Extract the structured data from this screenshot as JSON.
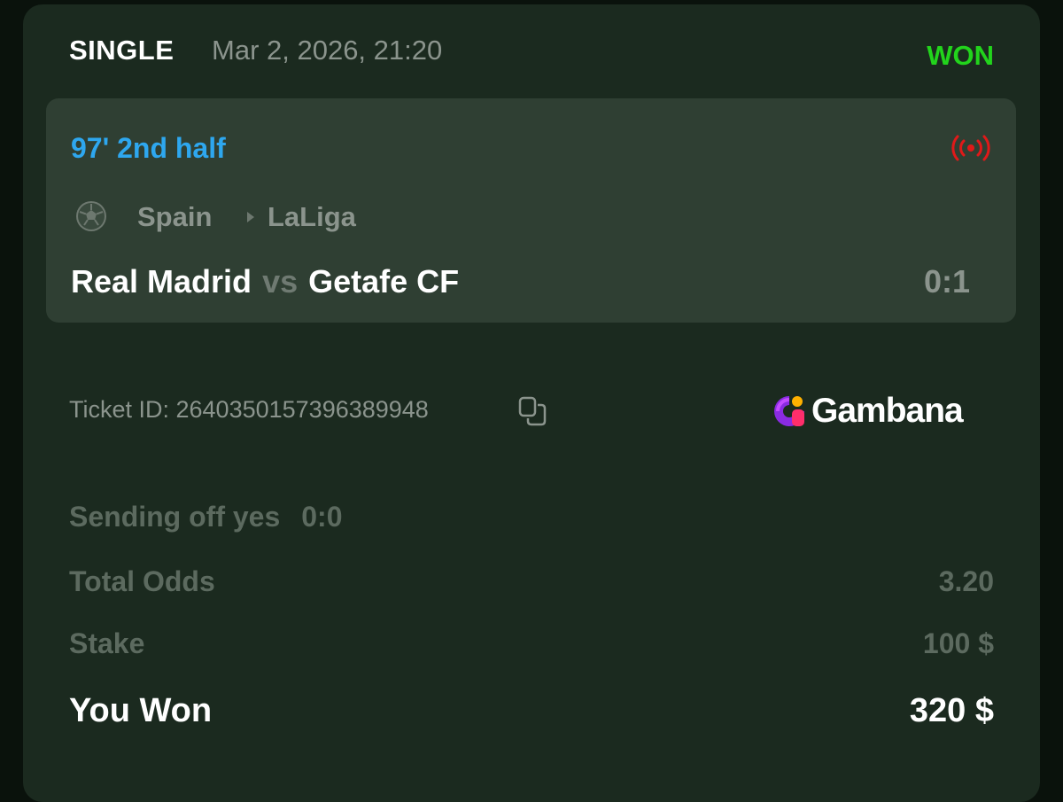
{
  "header": {
    "bet_type": "SINGLE",
    "date": "Mar 2, 2026, 21:20",
    "status": "WON"
  },
  "event": {
    "time_status": "97' 2nd half",
    "live_icon": "live-broadcast-icon",
    "sport_icon": "soccer-ball-icon",
    "country": "Spain",
    "league": "LaLiga",
    "home_team": "Real Madrid",
    "vs": "vs",
    "away_team": "Getafe CF",
    "score": "0:1"
  },
  "ticket": {
    "id_text": "Ticket ID: 2640350157396389948",
    "copy_icon": "copy-icon"
  },
  "brand": {
    "name": "Gambana",
    "logo_icon": "gambana-logo-icon"
  },
  "summary": {
    "selection": "Sending off yes",
    "selection_score": "0:0",
    "total_odds_label": "Total Odds",
    "total_odds_value": "3.20",
    "stake_label": "Stake",
    "stake_value": "100 $",
    "won_label": "You Won",
    "won_value": "320 $"
  },
  "colors": {
    "background": "#0a120c",
    "card": "#1b2a1f",
    "event_card": "#2f3f33",
    "won": "#22d41c",
    "time": "#2ea7ef",
    "live": "#e01919"
  }
}
